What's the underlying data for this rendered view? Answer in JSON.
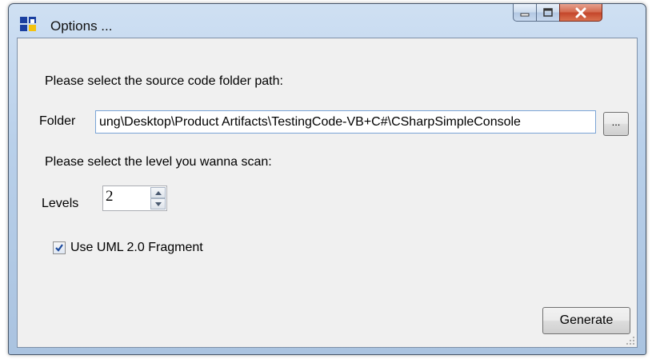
{
  "window": {
    "title": "Options ...",
    "controls": [
      "minimize-icon",
      "maximize-icon",
      "close-icon"
    ]
  },
  "folder_section": {
    "prompt": "Please select the source code folder path:",
    "label": "Folder",
    "value": "ung\\Desktop\\Product Artifacts\\TestingCode-VB+C#\\CSharpSimpleConsole",
    "browse_label": "..."
  },
  "level_section": {
    "prompt": "Please select the level you wanna scan:",
    "label": "Levels",
    "value": "2"
  },
  "uml_option": {
    "label": "Use UML 2.0 Fragment",
    "checked": true
  },
  "actions": {
    "generate_label": "Generate"
  },
  "colors": {
    "frame": "#b9d0ea",
    "client": "#f0f0f0",
    "close_button": "#c4452a",
    "input_border": "#7aa4d6"
  }
}
